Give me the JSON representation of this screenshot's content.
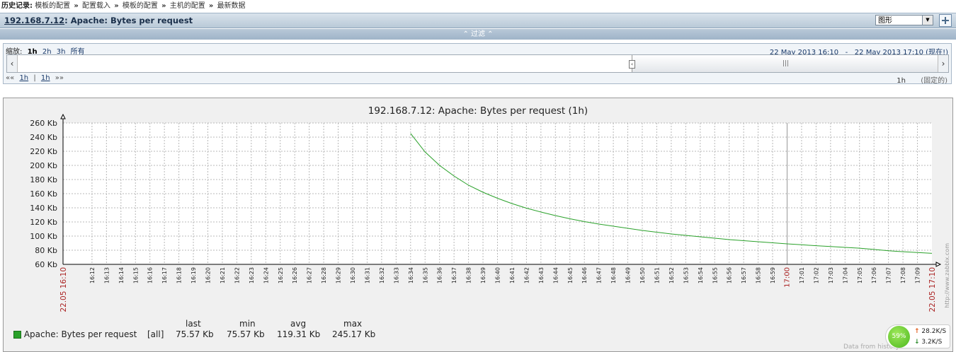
{
  "history": {
    "label": "历史记录:",
    "items": [
      "模板的配置",
      "配置载入",
      "模板的配置",
      "主机的配置",
      "最新数据"
    ],
    "separator": "»"
  },
  "titlebar": {
    "host": "192.168.7.12",
    "item": ": Apache: Bytes per request",
    "view_select": "图形"
  },
  "filter": {
    "label": "⌃ 过滤 ⌃"
  },
  "zoom": {
    "label": "缩放:",
    "current": "1h",
    "options": [
      "2h",
      "3h",
      "所有"
    ],
    "range_from": "22 May 2013 16:10",
    "range_sep": "-",
    "range_to": "22 May 2013 17:10 (现在!)",
    "nav_back_arrows": "««",
    "nav_back": "1h",
    "nav_divider": "|",
    "nav_fwd": "1h",
    "nav_fwd_arrows": "»»",
    "period": "1h",
    "fixed": "(固定的)"
  },
  "graph": {
    "title": "192.168.7.12: Apache: Bytes per request (1h)",
    "watermark": "http://www.zabbix.com",
    "data_from": "Data from history"
  },
  "chart_data": {
    "type": "line",
    "title": "192.168.7.12: Apache: Bytes per request (1h)",
    "y_ticks": [
      "60 Kb",
      "80 Kb",
      "100 Kb",
      "120 Kb",
      "140 Kb",
      "160 Kb",
      "180 Kb",
      "200 Kb",
      "220 Kb",
      "240 Kb",
      "260 Kb"
    ],
    "ylim": [
      60,
      260
    ],
    "y_unit": "Kb",
    "x_start_label": "22.05 16:10",
    "x_end_label": "22.05 17:10",
    "x_tick_labels": [
      "16:12",
      "16:13",
      "16:14",
      "16:15",
      "16:16",
      "16:17",
      "16:18",
      "16:19",
      "16:20",
      "16:21",
      "16:22",
      "16:23",
      "16:24",
      "16:25",
      "16:26",
      "16:27",
      "16:28",
      "16:29",
      "16:30",
      "16:31",
      "16:32",
      "16:33",
      "16:34",
      "16:35",
      "16:36",
      "16:37",
      "16:38",
      "16:39",
      "16:40",
      "16:41",
      "16:42",
      "16:43",
      "16:44",
      "16:45",
      "16:46",
      "16:47",
      "16:48",
      "16:49",
      "16:50",
      "16:51",
      "16:52",
      "16:53",
      "16:54",
      "16:55",
      "16:56",
      "16:57",
      "16:58",
      "16:59",
      "17:00",
      "17:01",
      "17:02",
      "17:03",
      "17:04",
      "17:05",
      "17:06",
      "17:07",
      "17:08",
      "17:09"
    ],
    "x_highlight": [
      "17:00"
    ],
    "grid": true,
    "series": [
      {
        "name": "Apache: Bytes per request",
        "color": "#2aa12a",
        "x": [
          "16:34",
          "16:35",
          "16:36",
          "16:37",
          "16:38",
          "16:39",
          "16:40",
          "16:41",
          "16:42",
          "16:43",
          "16:44",
          "16:45",
          "16:46",
          "16:47",
          "16:48",
          "16:49",
          "16:50",
          "16:51",
          "16:52",
          "16:53",
          "16:54",
          "16:55",
          "16:56",
          "16:57",
          "16:58",
          "16:59",
          "17:00",
          "17:01",
          "17:02",
          "17:03",
          "17:04",
          "17:05",
          "17:06",
          "17:07",
          "17:08",
          "17:09",
          "17:10"
        ],
        "y": [
          245.2,
          219,
          200,
          185,
          172,
          162,
          153.5,
          146,
          139.5,
          134,
          129,
          124.5,
          120.5,
          117,
          114,
          111,
          108,
          105.5,
          103,
          101,
          99,
          97,
          95,
          93.5,
          92,
          90.5,
          89,
          87.7,
          86.4,
          85.2,
          84,
          82.9,
          81.1,
          79.3,
          77.9,
          76.7,
          75.6
        ]
      }
    ],
    "legend": {
      "headers": [
        "last",
        "min",
        "avg",
        "max"
      ],
      "rows": [
        {
          "name": "Apache: Bytes per request",
          "func": "[all]",
          "last": "75.57 Kb",
          "min": "75.57 Kb",
          "avg": "119.31 Kb",
          "max": "245.17 Kb",
          "color": "#2aa12a"
        }
      ]
    }
  },
  "speed_widget": {
    "percent": "59%",
    "up": "28.2K/S",
    "down": "3.2K/S"
  }
}
